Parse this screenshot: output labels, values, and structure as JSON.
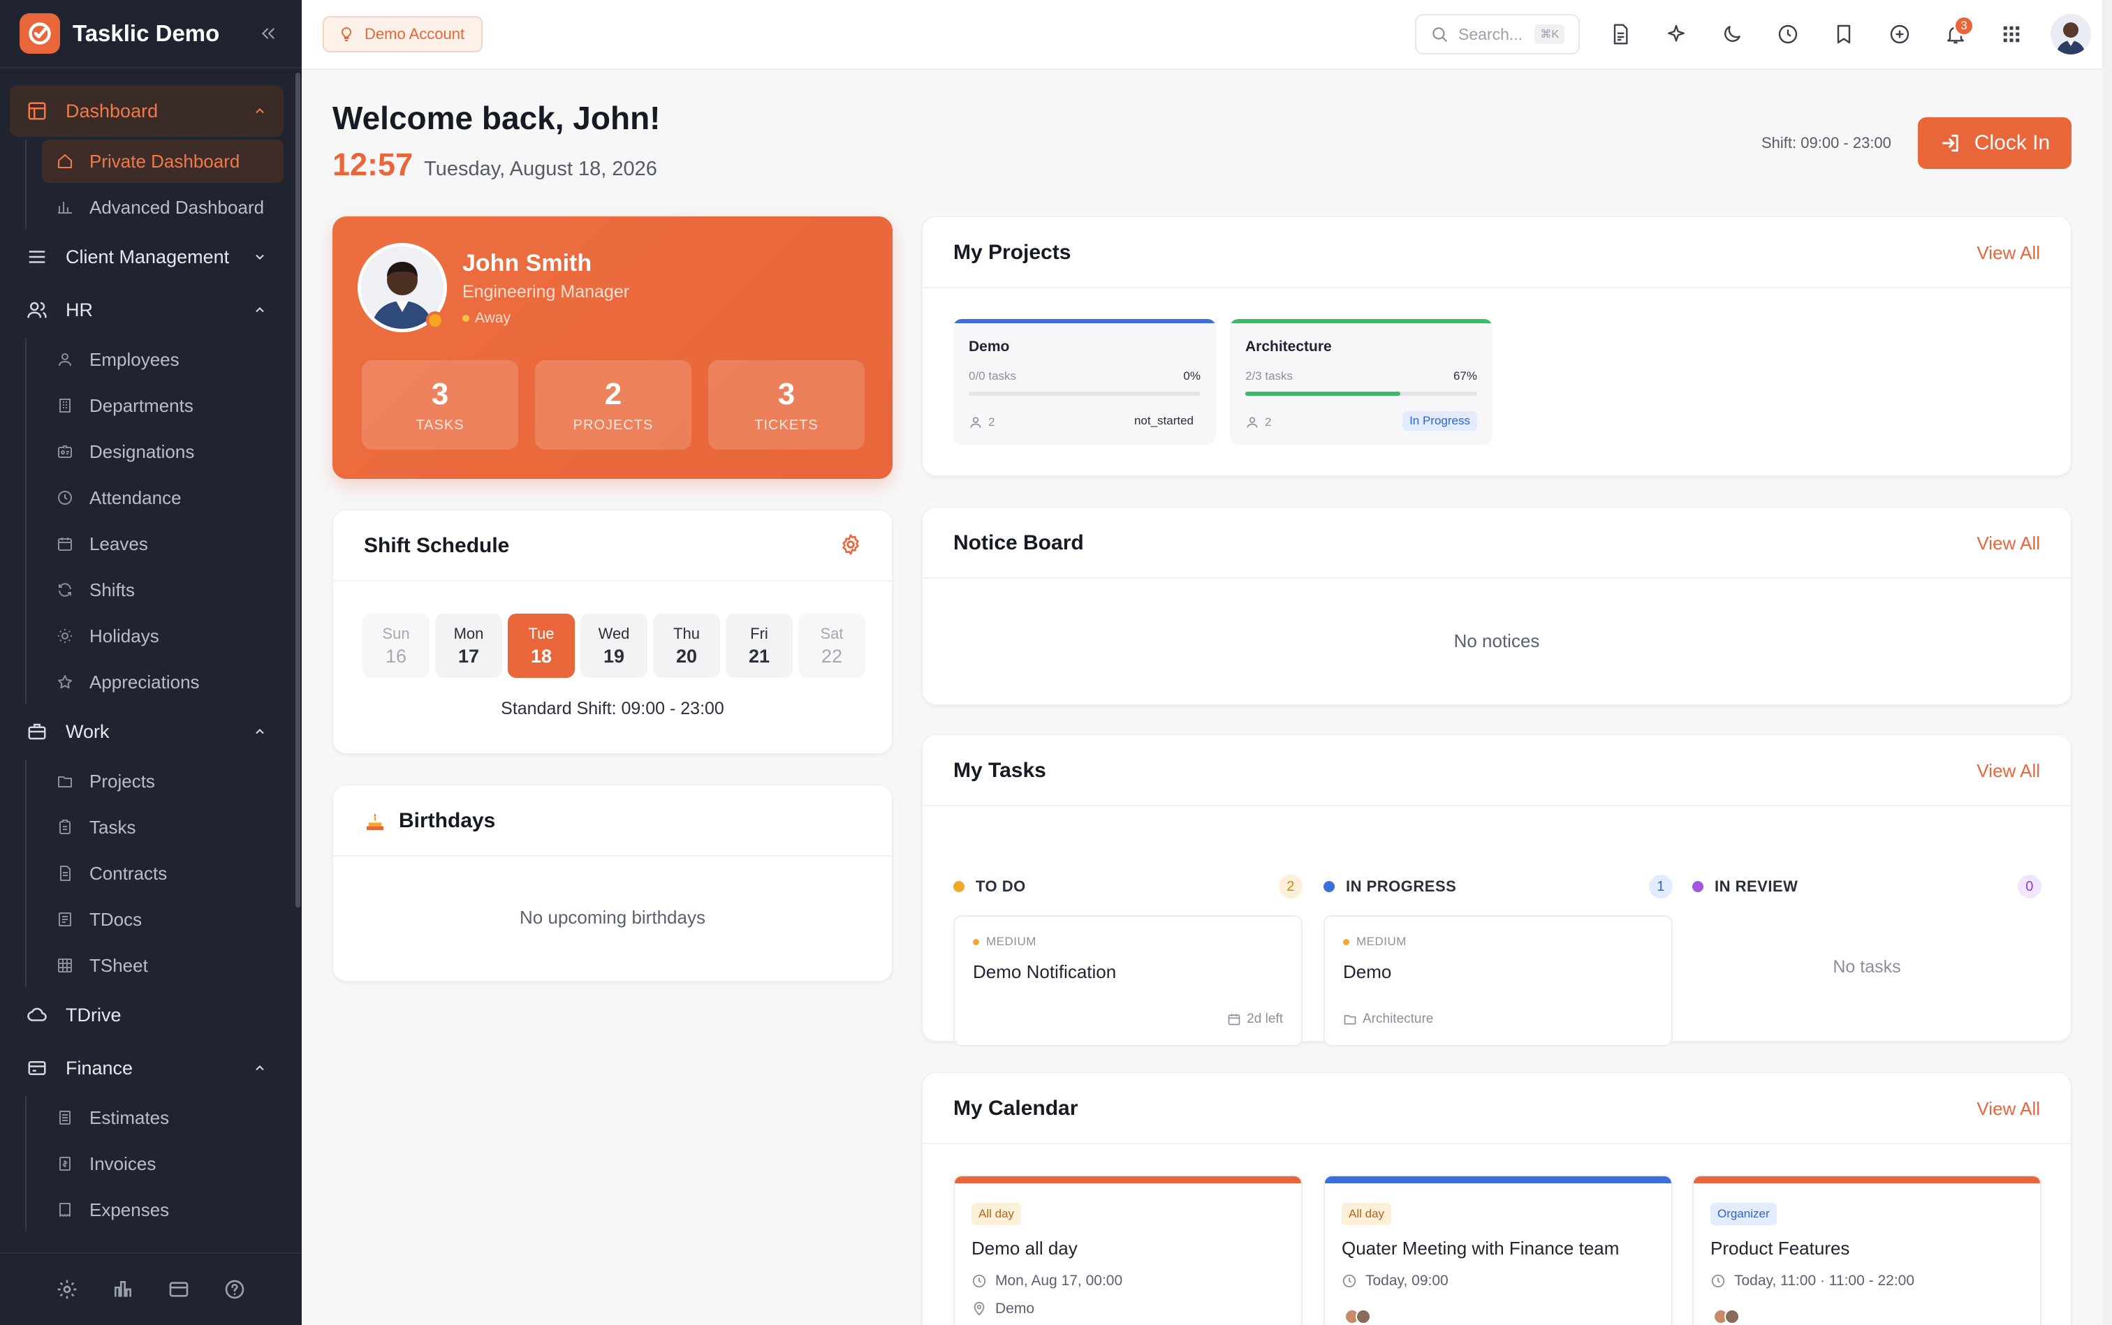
{
  "app": {
    "name": "Tasklic Demo"
  },
  "topbar": {
    "demo_badge": "Demo Account",
    "search_placeholder": "Search...",
    "search_shortcut": "⌘K",
    "notification_count": "3"
  },
  "sidebar": {
    "dashboard": {
      "label": "Dashboard",
      "items": [
        "Private Dashboard",
        "Advanced Dashboard"
      ]
    },
    "client_management": {
      "label": "Client Management"
    },
    "hr": {
      "label": "HR",
      "items": [
        "Employees",
        "Departments",
        "Designations",
        "Attendance",
        "Leaves",
        "Shifts",
        "Holidays",
        "Appreciations"
      ]
    },
    "work": {
      "label": "Work",
      "items": [
        "Projects",
        "Tasks",
        "Contracts",
        "TDocs",
        "TSheet"
      ]
    },
    "tdrive": {
      "label": "TDrive"
    },
    "finance": {
      "label": "Finance",
      "items": [
        "Estimates",
        "Invoices",
        "Expenses"
      ]
    }
  },
  "welcome": {
    "title": "Welcome back, John!",
    "time": "12:57",
    "date": "Tuesday, August 18, 2026",
    "shift": "Shift: 09:00 - 23:00",
    "clock_in": "Clock In"
  },
  "profile": {
    "name": "John Smith",
    "role": "Engineering Manager",
    "status": "Away",
    "stats": [
      {
        "value": "3",
        "label": "TASKS"
      },
      {
        "value": "2",
        "label": "PROJECTS"
      },
      {
        "value": "3",
        "label": "TICKETS"
      }
    ]
  },
  "shift_schedule": {
    "title": "Shift Schedule",
    "days": [
      {
        "name": "Sun",
        "date": "16"
      },
      {
        "name": "Mon",
        "date": "17"
      },
      {
        "name": "Tue",
        "date": "18"
      },
      {
        "name": "Wed",
        "date": "19"
      },
      {
        "name": "Thu",
        "date": "20"
      },
      {
        "name": "Fri",
        "date": "21"
      },
      {
        "name": "Sat",
        "date": "22"
      }
    ],
    "standard": "Standard Shift: 09:00 - 23:00"
  },
  "birthdays": {
    "title": "Birthdays",
    "empty": "No upcoming birthdays"
  },
  "projects": {
    "title": "My Projects",
    "view_all": "View All",
    "items": [
      {
        "name": "Demo",
        "tasks": "0/0 tasks",
        "percent": "0%",
        "progress": 0,
        "members": "2",
        "status": "not_started",
        "color": "#3b6fe0"
      },
      {
        "name": "Architecture",
        "tasks": "2/3 tasks",
        "percent": "67%",
        "progress": 0.67,
        "members": "2",
        "status": "In Progress",
        "color": "#3cb96a"
      }
    ]
  },
  "notice_board": {
    "title": "Notice Board",
    "view_all": "View All",
    "empty": "No notices"
  },
  "tasks": {
    "title": "My Tasks",
    "view_all": "View All",
    "columns": [
      {
        "label": "TO DO",
        "count": "2",
        "task": {
          "priority": "MEDIUM",
          "name": "Demo Notification",
          "meta": "2d left"
        }
      },
      {
        "label": "IN PROGRESS",
        "count": "1",
        "task": {
          "priority": "MEDIUM",
          "name": "Demo",
          "meta": "Architecture"
        }
      },
      {
        "label": "IN REVIEW",
        "count": "0",
        "empty": "No tasks"
      }
    ]
  },
  "calendar": {
    "title": "My Calendar",
    "view_all": "View All",
    "events": [
      {
        "tag": "All day",
        "name": "Demo all day",
        "time": "Mon, Aug 17, 00:00",
        "location": "Demo"
      },
      {
        "tag": "All day",
        "name": "Quater Meeting with Finance team",
        "time": "Today, 09:00"
      },
      {
        "tag": "Organizer",
        "name": "Product Features",
        "time": "Today, 11:00 · 11:00 - 22:00"
      }
    ]
  },
  "colors": {
    "accent": "#e8663a",
    "sidebar_bg": "#1f2430",
    "blue": "#3b6fe0",
    "green": "#3cb96a",
    "purple": "#a155e0"
  }
}
